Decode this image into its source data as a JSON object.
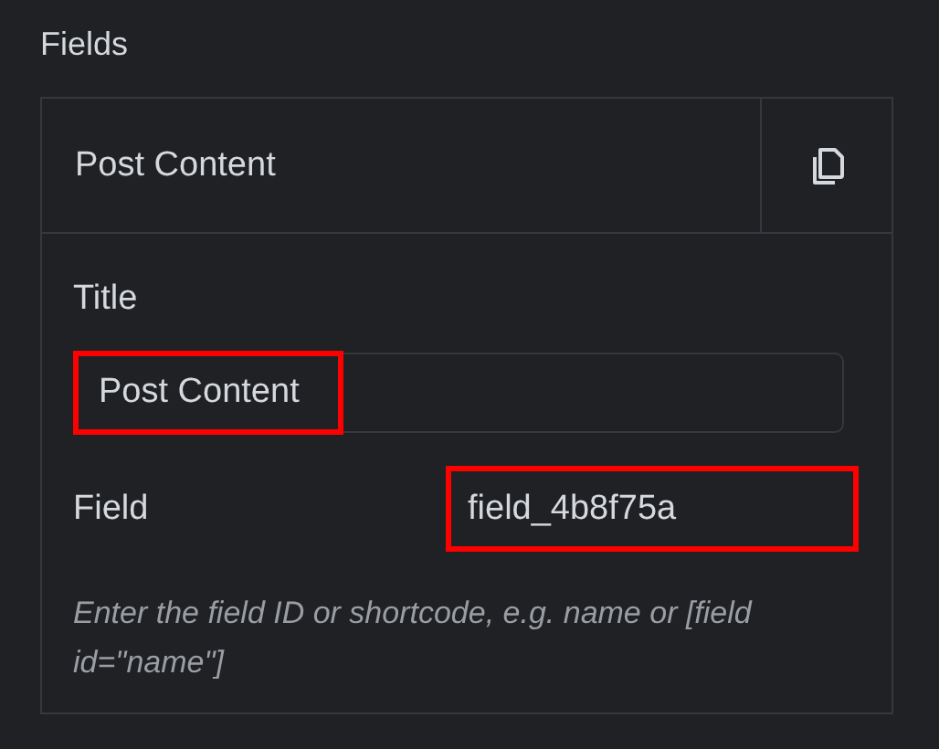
{
  "section_title": "Fields",
  "item": {
    "name": "Post Content",
    "title": {
      "label": "Title",
      "value": "Post Content",
      "highlighted": true
    },
    "field": {
      "label": "Field",
      "value": "field_4b8f75a",
      "highlighted": true
    },
    "help": "Enter the field ID or shortcode, e.g. name or [field id=\"name\"]"
  }
}
